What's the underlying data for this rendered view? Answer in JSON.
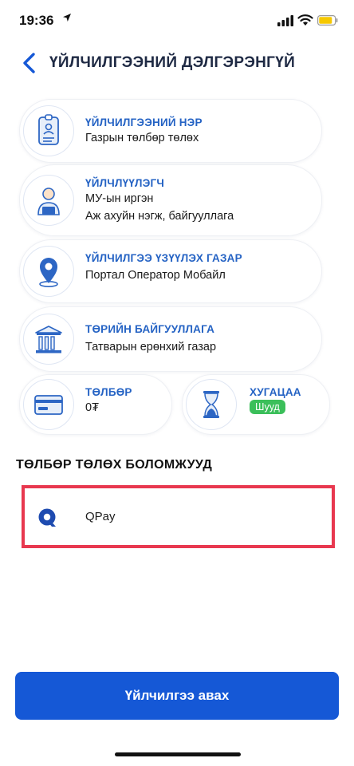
{
  "status_bar": {
    "time": "19:36"
  },
  "header": {
    "title": "ҮЙЛЧИЛГЭЭНИЙ ДЭЛГЭРЭНГҮЙ"
  },
  "cards": {
    "service_name": {
      "title": "ҮЙЛЧИЛГЭЭНИЙ НЭР",
      "lines": [
        "Газрын төлбөр төлөх"
      ],
      "icon": "id-card-icon"
    },
    "service_user": {
      "title": "ҮЙЛЧЛҮҮЛЭГЧ",
      "lines": [
        "МУ-ын иргэн",
        "Аж ахуйн нэгж, байгууллага"
      ],
      "icon": "user-icon"
    },
    "service_location": {
      "title": "ҮЙЛЧИЛГЭЭ ҮЗҮҮЛЭХ ГАЗАР",
      "lines": [
        "Портал  Оператор  Мобайл"
      ],
      "icon": "location-pin-icon"
    },
    "organization": {
      "title": "ТӨРИЙН БАЙГУУЛЛАГА",
      "lines": [
        "Татварын ерөнхий газар"
      ],
      "icon": "government-building-icon"
    },
    "fee": {
      "title": "ТӨЛБӨР",
      "value": "0₮",
      "icon": "credit-card-icon"
    },
    "duration": {
      "title": "ХУГАЦАА",
      "badge": "Шууд",
      "icon": "hourglass-icon"
    }
  },
  "payment": {
    "section_title": "ТӨЛБӨР ТӨЛӨХ БОЛОМЖУУД",
    "options": [
      {
        "label": "QPay",
        "icon": "qpay-logo-icon"
      }
    ]
  },
  "actions": {
    "primary_label": "Үйлчилгээ авах"
  },
  "colors": {
    "accent": "#1558d6",
    "title_blue": "#2563c4",
    "badge_green": "#3bbf5a",
    "highlight_red": "#e8384f"
  }
}
